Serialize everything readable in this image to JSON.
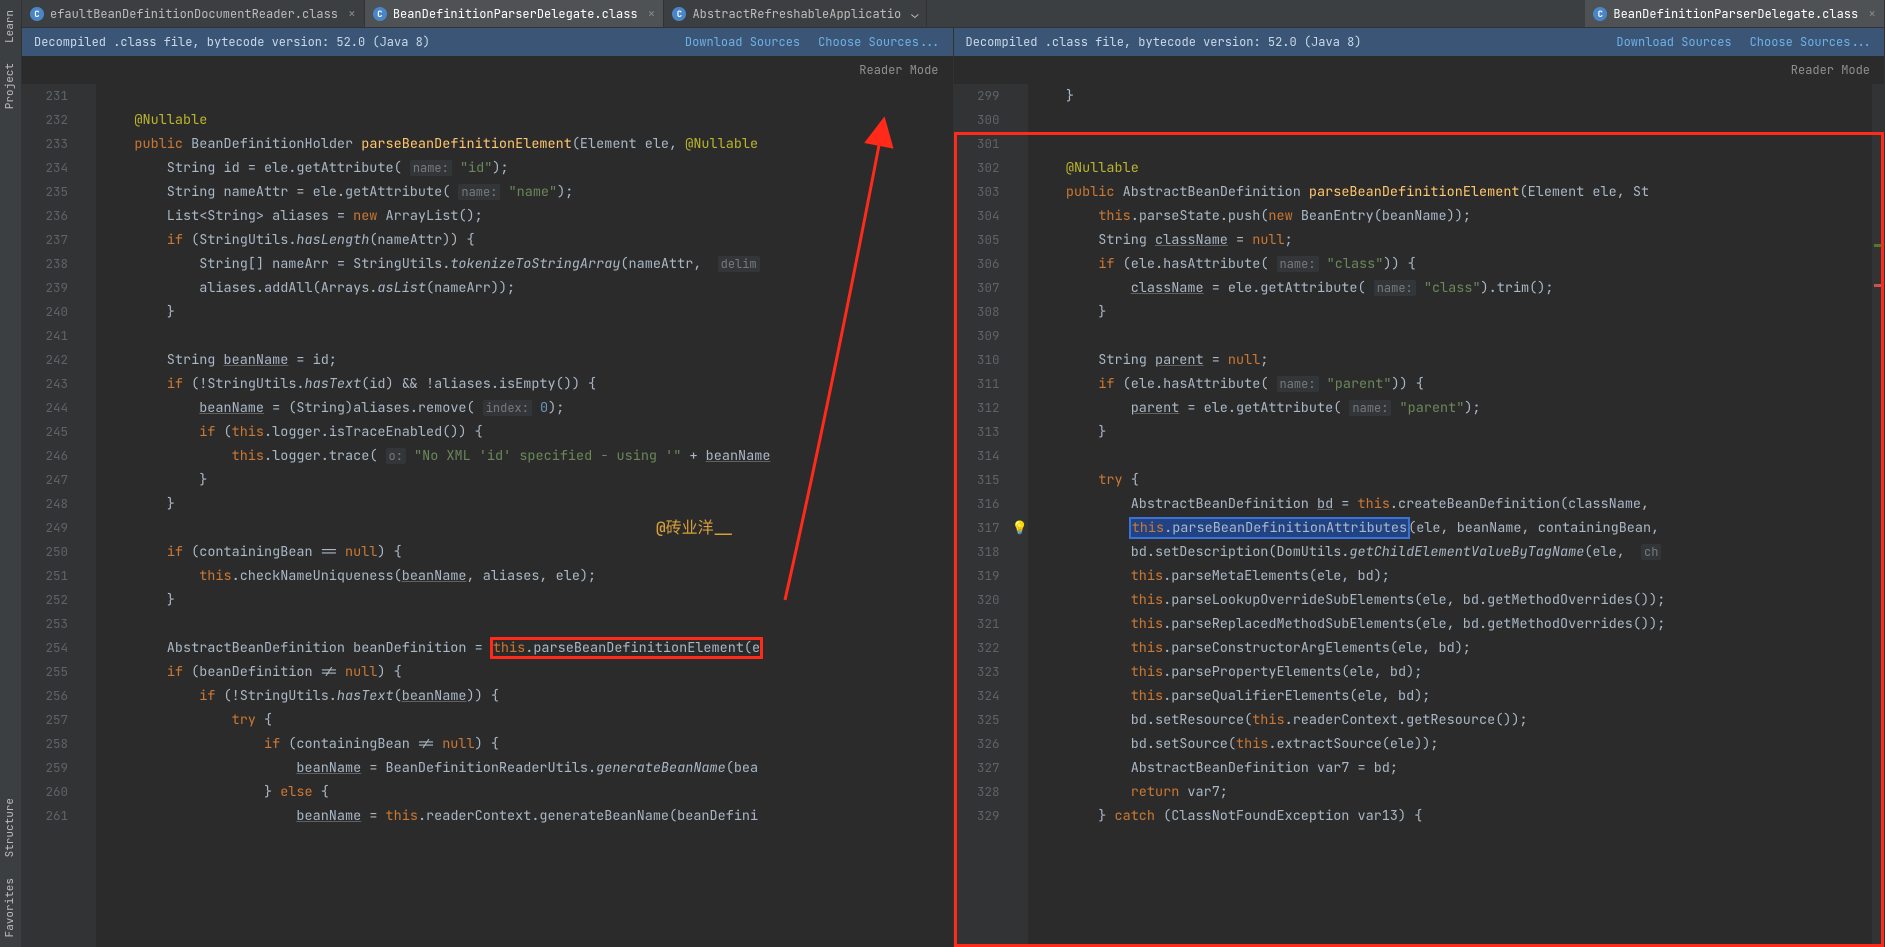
{
  "sideTools": [
    "Learn",
    "Project",
    "Structure",
    "Favorites"
  ],
  "tabs": [
    {
      "label": "efaultBeanDefinitionDocumentReader.class",
      "active": false,
      "icon": true,
      "close": true
    },
    {
      "label": "BeanDefinitionParserDelegate.class",
      "active": true,
      "icon": true,
      "close": true
    },
    {
      "label": "AbstractRefreshableApplicatio",
      "active": false,
      "icon": true,
      "close": false,
      "chevron": true
    },
    {
      "label": "BeanDefinitionParserDelegate.class",
      "active": true,
      "icon": true,
      "close": true
    }
  ],
  "infoBar": {
    "text": "Decompiled .class file, bytecode version: 52.0 (Java 8)",
    "link1": "Download Sources",
    "link2": "Choose Sources..."
  },
  "readerMode": "Reader Mode",
  "watermark": "@砖业洋__",
  "left": {
    "startLine": 231,
    "lines": [
      "",
      "    <span class='ann'>@Nullable</span>",
      "    <span class='kw'>public</span> BeanDefinitionHolder <span class='mtd'>parseBeanDefinitionElement</span>(Element ele, <span class='ann'>@Nullable</span>",
      "        String id = ele.getAttribute( <span class='hint'>name:</span> <span class='str'>\"id\"</span>);",
      "        String nameAttr = ele.getAttribute( <span class='hint'>name:</span> <span class='str'>\"name\"</span>);",
      "        List&lt;String&gt; aliases = <span class='kw'>new</span> ArrayList();",
      "        <span class='kw'>if</span> (StringUtils.<span class='ital'>hasLength</span>(nameAttr)) {",
      "            String[] nameArr = StringUtils.<span class='ital'>tokenizeToStringArray</span>(nameAttr,  <span class='hint'>delim</span>",
      "            aliases.addAll(Arrays.<span class='ital'>asList</span>(nameArr));",
      "        }",
      "",
      "        String <span class='ul'>beanName</span> = id;",
      "        <span class='kw'>if</span> (!StringUtils.<span class='ital'>hasText</span>(id) && !aliases.isEmpty()) {",
      "            <span class='ul'>beanName</span> = (String)aliases.remove( <span class='hint'>index:</span> <span class='num'>0</span>);",
      "            <span class='kw'>if</span> (<span class='kw'>this</span>.logger.isTraceEnabled()) {",
      "                <span class='kw'>this</span>.logger.trace( <span class='hint'>o:</span> <span class='str'>\"No XML 'id' specified - using '\"</span> + <span class='ul'>beanName</span>",
      "            }",
      "        }",
      "",
      "        <span class='kw'>if</span> (containingBean == <span class='kw'>null</span>) {",
      "            <span class='kw'>this</span>.checkNameUniqueness(<span class='ul'>beanName</span>, aliases, ele);",
      "        }",
      "",
      "        AbstractBeanDefinition beanDefinition = <span class='redbox' style='padding:1px 2px;'><span class='kw'>this</span>.parseBeanDefinitionElement(e</span>",
      "        <span class='kw'>if</span> (beanDefinition != <span class='kw'>null</span>) {",
      "            <span class='kw'>if</span> (!StringUtils.<span class='ital'>hasText</span>(<span class='ul'>beanName</span>)) {",
      "                <span class='kw'>try</span> {",
      "                    <span class='kw'>if</span> (containingBean != <span class='kw'>null</span>) {",
      "                        <span class='ul'>beanName</span> = BeanDefinitionReaderUtils.<span class='ital'>generateBeanName</span>(bea",
      "                    } <span class='kw'>else</span> {",
      "                        <span class='ul'>beanName</span> = <span class='kw'>this</span>.readerContext.generateBeanName(beanDefini"
    ]
  },
  "right": {
    "startLine": 299,
    "bulbLine": 317,
    "lines": [
      "    }",
      "",
      "",
      "    <span class='ann'>@Nullable</span>",
      "    <span class='kw'>public</span> AbstractBeanDefinition <span class='mtd'>parseBeanDefinitionElement</span>(Element ele, St",
      "        <span class='kw'>this</span>.parseState.push(<span class='kw'>new</span> BeanEntry(beanName));",
      "        String <span class='ul'>className</span> = <span class='kw'>null</span>;",
      "        <span class='kw'>if</span> (ele.hasAttribute( <span class='hint'>name:</span> <span class='str'>\"class\"</span>)) {",
      "            <span class='ul'>className</span> = ele.getAttribute( <span class='hint'>name:</span> <span class='str'>\"class\"</span>).trim();",
      "        }",
      "",
      "        String <span class='ul'>parent</span> = <span class='kw'>null</span>;",
      "        <span class='kw'>if</span> (ele.hasAttribute( <span class='hint'>name:</span> <span class='str'>\"parent\"</span>)) {",
      "            <span class='ul'>parent</span> = ele.getAttribute( <span class='hint'>name:</span> <span class='str'>\"parent\"</span>);",
      "        }",
      "",
      "        <span class='kw'>try</span> {",
      "            AbstractBeanDefinition <span class='ul'>bd</span> = <span class='kw'>this</span>.createBeanDefinition(className,",
      "            <span class='bluebox' style='padding:0 1px;'><span class='kw'>this</span>.parseBeanDefinitionAttributes</span>(ele, beanName, containingBean,",
      "            bd.setDescription(DomUtils.<span class='ital'>getChildElementValueByTagName</span>(ele,  <span class='hint'>ch</span>",
      "            <span class='kw'>this</span>.parseMetaElements(ele, bd);",
      "            <span class='kw'>this</span>.parseLookupOverrideSubElements(ele, bd.getMethodOverrides());",
      "            <span class='kw'>this</span>.parseReplacedMethodSubElements(ele, bd.getMethodOverrides());",
      "            <span class='kw'>this</span>.parseConstructorArgElements(ele, bd);",
      "            <span class='kw'>this</span>.parsePropertyElements(ele, bd);",
      "            <span class='kw'>this</span>.parseQualifierElements(ele, bd);",
      "            bd.setResource(<span class='kw'>this</span>.readerContext.getResource());",
      "            bd.setSource(<span class='kw'>this</span>.extractSource(ele));",
      "            AbstractBeanDefinition var7 = bd;",
      "            <span class='kw'>return</span> var7;",
      "        } <span class='kw'>catch</span> (ClassNotFoundException var13) {"
    ]
  }
}
